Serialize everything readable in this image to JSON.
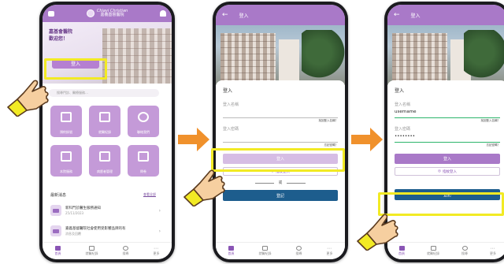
{
  "colors": {
    "accent": "#a979c8",
    "highlight": "#f2ea24",
    "arrow": "#f0912c",
    "register": "#1d5d8d"
  },
  "home": {
    "brand_en": "Chiayi Christian",
    "brand_zh": "嘉義基督醫院",
    "greeting_line1": "嘉基會醫院",
    "greeting_line2": "歡迎您！",
    "login_label": "登入",
    "search_placeholder": "搜尋門診、醫療服務…",
    "tiles": [
      {
        "label": "預約掛號"
      },
      {
        "label": "就醫紀錄"
      },
      {
        "label": "聯絡我們"
      },
      {
        "label": "本院服務"
      },
      {
        "label": "病歷者管理"
      },
      {
        "label": "問卷"
      }
    ],
    "news_title": "最新消息",
    "news_more": "查看全部",
    "news": [
      {
        "title": "新科門診醫生服務通知",
        "date": "25/11/2023"
      },
      {
        "title": "嘉義基督醫院社會使用受影響品牌的有",
        "date": "消息及回覆"
      }
    ],
    "tabs": [
      "首頁",
      "就醫紀錄",
      "搜尋",
      "更多"
    ]
  },
  "login_empty": {
    "title": "登入",
    "card_title": "登入",
    "user_label": "登入名稱",
    "user_value": "",
    "user_hint": "找回登入名稱？",
    "pw_label": "登入密碼",
    "pw_value": "",
    "pw_hint": "忘記密碼？",
    "login_button": "登入",
    "face_button": "指紋登入",
    "or_label": "或",
    "register_button": "登記",
    "tabs": [
      "首頁",
      "就醫紀錄",
      "搜尋",
      "更多"
    ]
  },
  "login_filled": {
    "title": "登入",
    "card_title": "登入",
    "user_label": "登入名稱",
    "user_value": "username",
    "user_hint": "找回登入名稱？",
    "pw_label": "登入密碼",
    "pw_value": "••••••••",
    "pw_hint": "忘記密碼？",
    "login_button": "登入",
    "face_button": "指紋登入",
    "register_button": "登記",
    "tabs": [
      "首頁",
      "就醫紀錄",
      "搜尋",
      "更多"
    ]
  }
}
